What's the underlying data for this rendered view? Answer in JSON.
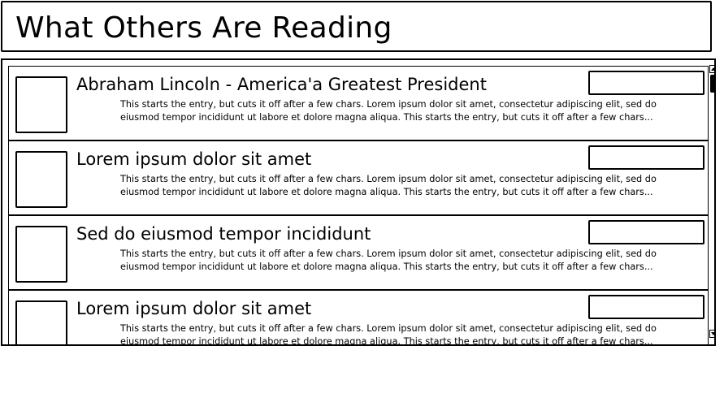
{
  "header": {
    "title": "What Others Are Reading"
  },
  "entries": [
    {
      "title": "Abraham Lincoln - America'a Greatest President",
      "snippet": "This starts the entry, but cuts it off after a few chars. Lorem ipsum dolor sit amet, consectetur adipiscing elit, sed do eiusmod tempor incididunt ut labore et dolore magna aliqua. This starts the entry, but cuts it off after a few chars..."
    },
    {
      "title": "Lorem ipsum dolor sit amet",
      "snippet": "This starts the entry, but cuts it off after a few chars. Lorem ipsum dolor sit amet, consectetur adipiscing elit, sed do eiusmod tempor incididunt ut labore et dolore magna aliqua. This starts the entry, but cuts it off after a few chars..."
    },
    {
      "title": "Sed do eiusmod tempor incididunt",
      "snippet": "This starts the entry, but cuts it off after a few chars. Lorem ipsum dolor sit amet, consectetur adipiscing elit, sed do eiusmod tempor incididunt ut labore et dolore magna aliqua. This starts the entry, but cuts it off after a few chars..."
    },
    {
      "title": "Lorem ipsum dolor sit amet",
      "snippet": "This starts the entry, but cuts it off after a few chars. Lorem ipsum dolor sit amet, consectetur adipiscing elit, sed do eiusmod tempor incididunt ut labore et dolore magna aliqua. This starts the entry, but cuts it off after a few chars..."
    }
  ]
}
